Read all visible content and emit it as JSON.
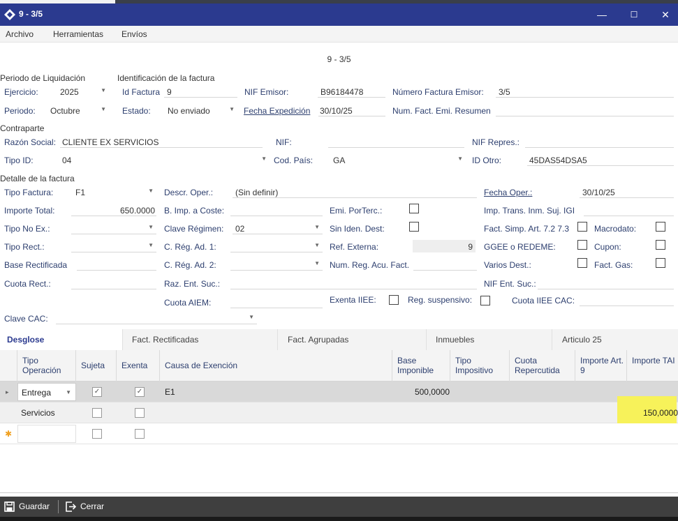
{
  "window": {
    "title": "9 - 3/5",
    "minimize": "—",
    "maximize": "☐",
    "close": "✕"
  },
  "menu": {
    "archivo": "Archivo",
    "herramientas": "Herramientas",
    "envios": "Envíos"
  },
  "form_title": "9 - 3/5",
  "periodo": {
    "section": "Periodo de Liquidación",
    "ejercicio_label": "Ejercicio:",
    "ejercicio_value": "2025",
    "periodo_label": "Periodo:",
    "periodo_value": "Octubre"
  },
  "identificacion": {
    "section": "Identificación de la factura",
    "id_label": "Id Factura",
    "id_value": "9",
    "estado_label": "Estado:",
    "estado_value": "No enviado",
    "nif_emisor_label": "NIF Emisor:",
    "nif_emisor_value": "B96184478",
    "fecha_exp_label": "Fecha Expedición",
    "fecha_exp_value": "30/10/25",
    "num_fact_label": "Número Factura Emisor:",
    "num_fact_value": "3/5",
    "num_resumen_label": "Num. Fact. Emi. Resumen"
  },
  "contraparte": {
    "section": "Contraparte",
    "razon_label": "Razón Social:",
    "razon_value": "CLIENTE EX SERVICIOS",
    "nif_label": "NIF:",
    "nif_repres_label": "NIF Repres.:",
    "tipo_id_label": "Tipo ID:",
    "tipo_id_value": "04",
    "cod_pais_label": "Cod. País:",
    "cod_pais_value": "GA",
    "id_otro_label": "ID Otro:",
    "id_otro_value": "45DAS54DSA5"
  },
  "detalle": {
    "section": "Detalle de la factura",
    "tipo_factura_label": "Tipo Factura:",
    "tipo_factura_value": "F1",
    "descr_label": "Descr. Oper.:",
    "descr_value": "(Sin definir)",
    "fecha_oper_label": "Fecha Oper.:",
    "fecha_oper_value": "30/10/25",
    "importe_total_label": "Importe Total:",
    "importe_total_value": "650.0000",
    "bimp_coste_label": "B. Imp. a Coste:",
    "emi_porterc_label": "Emi. PorTerc.:",
    "imp_trans_label": "Imp. Trans. Inm. Suj. IGI",
    "tipo_noex_label": "Tipo No Ex.:",
    "clave_reg_label": "Clave Régimen:",
    "clave_reg_value": "02",
    "sin_iden_label": "Sin Iden. Dest:",
    "fact_simp_label": "Fact. Simp. Art. 7.2 7.3",
    "macrodato_label": "Macrodato:",
    "tipo_rect_label": "Tipo Rect.:",
    "creg1_label": "C. Rég. Ad. 1:",
    "ref_ext_label": "Ref. Externa:",
    "ref_ext_value": "9",
    "ggee_label": "GGEE o REDEME:",
    "cupon_label": "Cupon:",
    "base_rect_label": "Base Rectificada",
    "creg2_label": "C. Rég. Ad. 2:",
    "num_reg_label": "Num. Reg. Acu. Fact.",
    "varios_label": "Varios Dest.:",
    "fact_gas_label": "Fact. Gas:",
    "cuota_rect_label": "Cuota Rect.:",
    "raz_ent_label": "Raz. Ent. Suc.:",
    "nif_ent_label": "NIF Ent. Suc.:",
    "cuota_aiem_label": "Cuota AIEM:",
    "exenta_ieee_label": "Exenta IIEE:",
    "reg_susp_label": "Reg. suspensivo:",
    "cuota_iiee_label": "Cuota IIEE CAC:",
    "clave_cac_label": "Clave CAC:"
  },
  "tabs": [
    "Desglose",
    "Fact. Rectificadas",
    "Fact. Agrupadas",
    "Inmuebles",
    "Articulo 25"
  ],
  "grid": {
    "headers": [
      "Tipo Operación",
      "Sujeta",
      "Exenta",
      "Causa de Exención",
      "Base Imponible",
      "Tipo Impositivo",
      "Cuota Repercutida",
      "Importe Art. 9",
      "Importe TAI"
    ],
    "rows": [
      {
        "tipo": "Entrega",
        "sujeta": "✓",
        "exenta": "✓",
        "causa": "E1",
        "base": "500,0000",
        "importe_tai": ""
      },
      {
        "tipo": "Servicios",
        "sujeta": "",
        "exenta": "",
        "causa": "",
        "base": "",
        "importe_tai": "150,0000"
      }
    ],
    "row_indicator": "▸",
    "new_row_indicator": "✱"
  },
  "footer": {
    "guardar": "Guardar",
    "cerrar": "Cerrar"
  },
  "colors": {
    "titlebar": "#2b3a8f",
    "label": "#2c3e6e",
    "highlight": "#f7f25a",
    "footer": "#3f3f3f"
  }
}
